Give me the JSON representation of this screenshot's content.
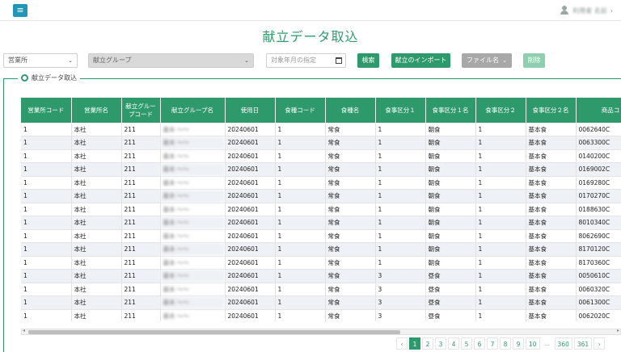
{
  "header": {
    "menu_icon": "≡",
    "user_name": "利用者 名前",
    "caret": "›"
  },
  "page": {
    "title": "献立データ取込"
  },
  "filters": {
    "office": "営業所",
    "group": "献立グループ",
    "date_placeholder": "対象年月の指定",
    "search_label": "検索",
    "import_label": "献立のインポート",
    "file_name": "ファイル名",
    "delete_label": "削除",
    "caret": "⌄"
  },
  "panel": {
    "legend": "献立データ取込"
  },
  "table": {
    "columns": [
      "営業所コード",
      "営業所名",
      "献立グループコード",
      "献立グループ名",
      "使用日",
      "食種コード",
      "食種名",
      "食事区分１",
      "食事区分１名",
      "食事区分２",
      "食事区分２名",
      "商品コ"
    ],
    "rows": [
      [
        "1",
        "本社",
        "211",
        "基本 ～～",
        "20240601",
        "1",
        "常食",
        "1",
        "朝食",
        "1",
        "基本食",
        "0062640C"
      ],
      [
        "1",
        "本社",
        "211",
        "基本 ～～",
        "20240601",
        "1",
        "常食",
        "1",
        "朝食",
        "1",
        "基本食",
        "0063300C"
      ],
      [
        "1",
        "本社",
        "211",
        "基本 ～～",
        "20240601",
        "1",
        "常食",
        "1",
        "朝食",
        "1",
        "基本食",
        "0140200C"
      ],
      [
        "1",
        "本社",
        "211",
        "基本 ～～",
        "20240601",
        "1",
        "常食",
        "1",
        "朝食",
        "1",
        "基本食",
        "0169002C"
      ],
      [
        "1",
        "本社",
        "211",
        "基本 ～～",
        "20240601",
        "1",
        "常食",
        "1",
        "朝食",
        "1",
        "基本食",
        "0169280C"
      ],
      [
        "1",
        "本社",
        "211",
        "基本 ～～",
        "20240601",
        "1",
        "常食",
        "1",
        "朝食",
        "1",
        "基本食",
        "0170270C"
      ],
      [
        "1",
        "本社",
        "211",
        "基本 ～～",
        "20240601",
        "1",
        "常食",
        "1",
        "朝食",
        "1",
        "基本食",
        "0188630C"
      ],
      [
        "1",
        "本社",
        "211",
        "基本 ～～",
        "20240601",
        "1",
        "常食",
        "1",
        "朝食",
        "1",
        "基本食",
        "8010340C"
      ],
      [
        "1",
        "本社",
        "211",
        "基本 ～～",
        "20240601",
        "1",
        "常食",
        "1",
        "朝食",
        "1",
        "基本食",
        "8062690C"
      ],
      [
        "1",
        "本社",
        "211",
        "基本 ～～",
        "20240601",
        "1",
        "常食",
        "1",
        "朝食",
        "1",
        "基本食",
        "8170120C"
      ],
      [
        "1",
        "本社",
        "211",
        "基本 ～～",
        "20240601",
        "1",
        "常食",
        "1",
        "朝食",
        "1",
        "基本食",
        "8170360C"
      ],
      [
        "1",
        "本社",
        "211",
        "基本 ～～",
        "20240601",
        "1",
        "常食",
        "3",
        "昼食",
        "1",
        "基本食",
        "0050610C"
      ],
      [
        "1",
        "本社",
        "211",
        "基本 ～～",
        "20240601",
        "1",
        "常食",
        "3",
        "昼食",
        "1",
        "基本食",
        "0060320C"
      ],
      [
        "1",
        "本社",
        "211",
        "基本 ～～",
        "20240601",
        "1",
        "常食",
        "3",
        "昼食",
        "1",
        "基本食",
        "0061300C"
      ],
      [
        "1",
        "本社",
        "211",
        "基本 ～～",
        "20240601",
        "1",
        "常食",
        "3",
        "昼食",
        "1",
        "基本食",
        "0062020C"
      ]
    ]
  },
  "pagination": {
    "prev": "‹",
    "next": "›",
    "pages": [
      "1",
      "2",
      "3",
      "4",
      "5",
      "6",
      "7",
      "8",
      "9",
      "10",
      "...",
      "360",
      "361"
    ],
    "active": "1"
  },
  "colors": {
    "accent": "#2e9a6c",
    "menu": "#2196b6",
    "row_alt": "#eef1f6"
  }
}
